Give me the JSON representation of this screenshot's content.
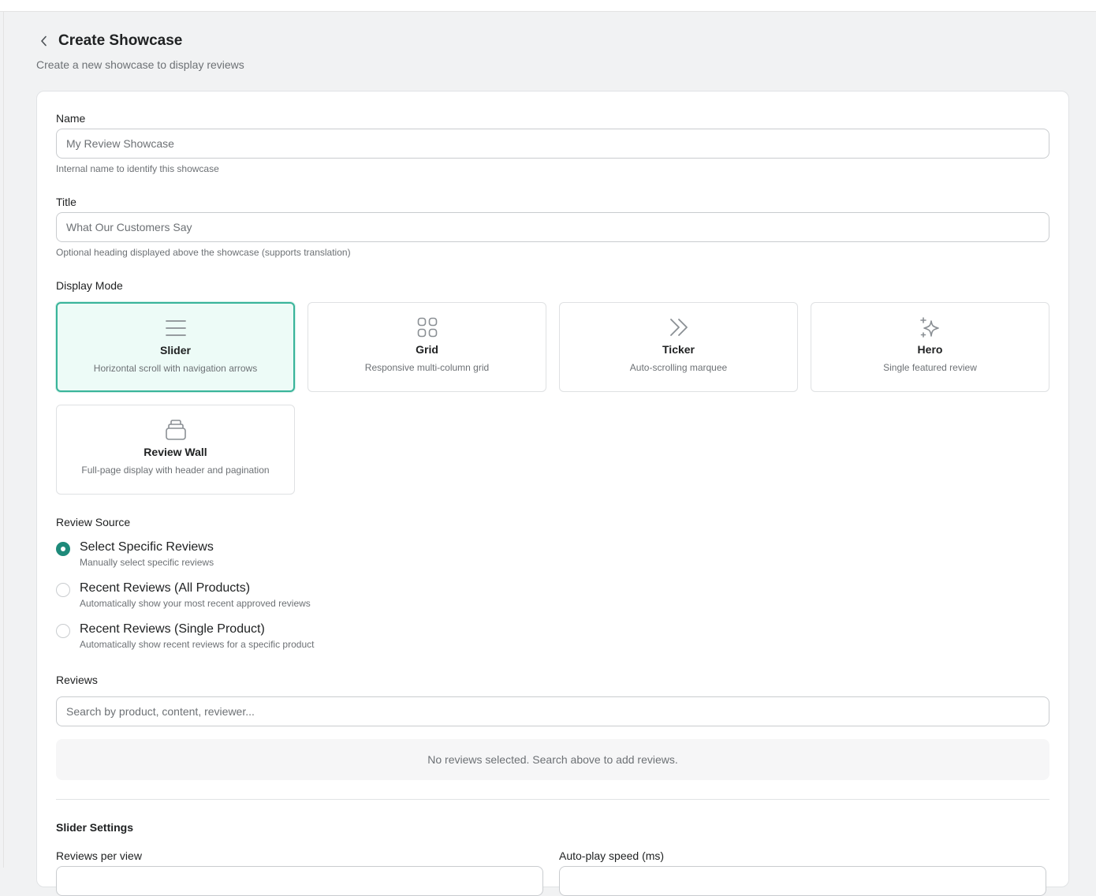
{
  "header": {
    "title": "Create Showcase",
    "subtitle": "Create a new showcase to display reviews"
  },
  "form": {
    "name": {
      "label": "Name",
      "placeholder": "My Review Showcase",
      "help": "Internal name to identify this showcase"
    },
    "title": {
      "label": "Title",
      "placeholder": "What Our Customers Say",
      "help": "Optional heading displayed above the showcase (supports translation)"
    },
    "display_mode": {
      "label": "Display Mode",
      "selected": "Slider",
      "options": [
        {
          "title": "Slider",
          "desc": "Horizontal scroll with navigation arrows",
          "icon": "menu-lines-icon"
        },
        {
          "title": "Grid",
          "desc": "Responsive multi-column grid",
          "icon": "grid-icon"
        },
        {
          "title": "Ticker",
          "desc": "Auto-scrolling marquee",
          "icon": "chevrons-right-icon"
        },
        {
          "title": "Hero",
          "desc": "Single featured review",
          "icon": "sparkles-icon"
        },
        {
          "title": "Review Wall",
          "desc": "Full-page display with header and pagination",
          "icon": "stack-icon"
        }
      ]
    },
    "review_source": {
      "label": "Review Source",
      "selected": "Select Specific Reviews",
      "options": [
        {
          "title": "Select Specific Reviews",
          "desc": "Manually select specific reviews"
        },
        {
          "title": "Recent Reviews (All Products)",
          "desc": "Automatically show your most recent approved reviews"
        },
        {
          "title": "Recent Reviews (Single Product)",
          "desc": "Automatically show recent reviews for a specific product"
        }
      ]
    },
    "reviews": {
      "label": "Reviews",
      "placeholder": "Search by product, content, reviewer...",
      "empty_text": "No reviews selected. Search above to add reviews."
    },
    "slider_settings": {
      "title": "Slider Settings",
      "reviews_per_view_label": "Reviews per view",
      "autoplay_speed_label": "Auto-play speed (ms)"
    }
  },
  "colors": {
    "accent": "#1e8a7a",
    "selected_bg": "#edfbf7",
    "selected_border": "#39b49a"
  }
}
